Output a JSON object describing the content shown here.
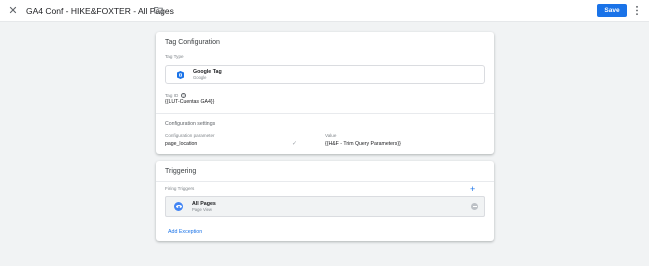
{
  "header": {
    "title": "GA4 Conf - HIKE&FOXTER - All Pages",
    "save_label": "Save"
  },
  "icons": {
    "close": "close-icon",
    "folder": "folder-icon",
    "more": "more-vert-icon",
    "tag": "google-tag-icon",
    "help": "help-icon",
    "check": "check-icon",
    "add": "add-icon",
    "trigger": "pageview-eye-icon",
    "remove": "remove-icon"
  },
  "colors": {
    "accent": "#1a73e8",
    "trigger_icon": "#4285f4"
  },
  "tag_configuration": {
    "title": "Tag Configuration",
    "tag_type_label": "Tag Type",
    "tag_type_name": "Google Tag",
    "tag_type_vendor": "Google",
    "tag_id_label": "Tag ID",
    "tag_id_value": "{{LUT-Cuentas GA4}}",
    "config_settings_title": "Configuration settings",
    "param_label": "Configuration parameter",
    "value_label": "Value",
    "parameters": [
      {
        "name": "page_location",
        "value": "{{H&F - Trim Query Parameters}}"
      }
    ]
  },
  "triggering": {
    "title": "Triggering",
    "firing_label": "Firing Triggers",
    "triggers": [
      {
        "name": "All Pages",
        "type": "Page View"
      }
    ],
    "add_exception_label": "Add Exception"
  }
}
